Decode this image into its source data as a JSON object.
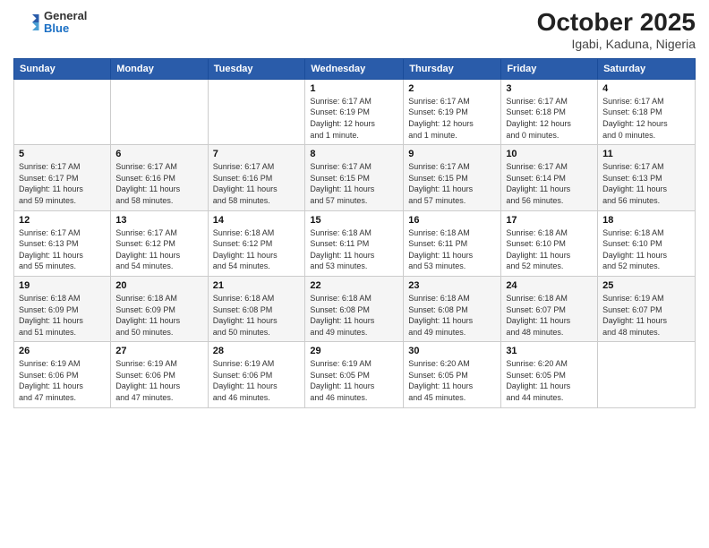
{
  "header": {
    "logo": {
      "general": "General",
      "blue": "Blue"
    },
    "title": "October 2025",
    "subtitle": "Igabi, Kaduna, Nigeria"
  },
  "calendar": {
    "days_of_week": [
      "Sunday",
      "Monday",
      "Tuesday",
      "Wednesday",
      "Thursday",
      "Friday",
      "Saturday"
    ],
    "weeks": [
      [
        {
          "day": "",
          "info": ""
        },
        {
          "day": "",
          "info": ""
        },
        {
          "day": "",
          "info": ""
        },
        {
          "day": "1",
          "info": "Sunrise: 6:17 AM\nSunset: 6:19 PM\nDaylight: 12 hours\nand 1 minute."
        },
        {
          "day": "2",
          "info": "Sunrise: 6:17 AM\nSunset: 6:19 PM\nDaylight: 12 hours\nand 1 minute."
        },
        {
          "day": "3",
          "info": "Sunrise: 6:17 AM\nSunset: 6:18 PM\nDaylight: 12 hours\nand 0 minutes."
        },
        {
          "day": "4",
          "info": "Sunrise: 6:17 AM\nSunset: 6:18 PM\nDaylight: 12 hours\nand 0 minutes."
        }
      ],
      [
        {
          "day": "5",
          "info": "Sunrise: 6:17 AM\nSunset: 6:17 PM\nDaylight: 11 hours\nand 59 minutes."
        },
        {
          "day": "6",
          "info": "Sunrise: 6:17 AM\nSunset: 6:16 PM\nDaylight: 11 hours\nand 58 minutes."
        },
        {
          "day": "7",
          "info": "Sunrise: 6:17 AM\nSunset: 6:16 PM\nDaylight: 11 hours\nand 58 minutes."
        },
        {
          "day": "8",
          "info": "Sunrise: 6:17 AM\nSunset: 6:15 PM\nDaylight: 11 hours\nand 57 minutes."
        },
        {
          "day": "9",
          "info": "Sunrise: 6:17 AM\nSunset: 6:15 PM\nDaylight: 11 hours\nand 57 minutes."
        },
        {
          "day": "10",
          "info": "Sunrise: 6:17 AM\nSunset: 6:14 PM\nDaylight: 11 hours\nand 56 minutes."
        },
        {
          "day": "11",
          "info": "Sunrise: 6:17 AM\nSunset: 6:13 PM\nDaylight: 11 hours\nand 56 minutes."
        }
      ],
      [
        {
          "day": "12",
          "info": "Sunrise: 6:17 AM\nSunset: 6:13 PM\nDaylight: 11 hours\nand 55 minutes."
        },
        {
          "day": "13",
          "info": "Sunrise: 6:17 AM\nSunset: 6:12 PM\nDaylight: 11 hours\nand 54 minutes."
        },
        {
          "day": "14",
          "info": "Sunrise: 6:18 AM\nSunset: 6:12 PM\nDaylight: 11 hours\nand 54 minutes."
        },
        {
          "day": "15",
          "info": "Sunrise: 6:18 AM\nSunset: 6:11 PM\nDaylight: 11 hours\nand 53 minutes."
        },
        {
          "day": "16",
          "info": "Sunrise: 6:18 AM\nSunset: 6:11 PM\nDaylight: 11 hours\nand 53 minutes."
        },
        {
          "day": "17",
          "info": "Sunrise: 6:18 AM\nSunset: 6:10 PM\nDaylight: 11 hours\nand 52 minutes."
        },
        {
          "day": "18",
          "info": "Sunrise: 6:18 AM\nSunset: 6:10 PM\nDaylight: 11 hours\nand 52 minutes."
        }
      ],
      [
        {
          "day": "19",
          "info": "Sunrise: 6:18 AM\nSunset: 6:09 PM\nDaylight: 11 hours\nand 51 minutes."
        },
        {
          "day": "20",
          "info": "Sunrise: 6:18 AM\nSunset: 6:09 PM\nDaylight: 11 hours\nand 50 minutes."
        },
        {
          "day": "21",
          "info": "Sunrise: 6:18 AM\nSunset: 6:08 PM\nDaylight: 11 hours\nand 50 minutes."
        },
        {
          "day": "22",
          "info": "Sunrise: 6:18 AM\nSunset: 6:08 PM\nDaylight: 11 hours\nand 49 minutes."
        },
        {
          "day": "23",
          "info": "Sunrise: 6:18 AM\nSunset: 6:08 PM\nDaylight: 11 hours\nand 49 minutes."
        },
        {
          "day": "24",
          "info": "Sunrise: 6:18 AM\nSunset: 6:07 PM\nDaylight: 11 hours\nand 48 minutes."
        },
        {
          "day": "25",
          "info": "Sunrise: 6:19 AM\nSunset: 6:07 PM\nDaylight: 11 hours\nand 48 minutes."
        }
      ],
      [
        {
          "day": "26",
          "info": "Sunrise: 6:19 AM\nSunset: 6:06 PM\nDaylight: 11 hours\nand 47 minutes."
        },
        {
          "day": "27",
          "info": "Sunrise: 6:19 AM\nSunset: 6:06 PM\nDaylight: 11 hours\nand 47 minutes."
        },
        {
          "day": "28",
          "info": "Sunrise: 6:19 AM\nSunset: 6:06 PM\nDaylight: 11 hours\nand 46 minutes."
        },
        {
          "day": "29",
          "info": "Sunrise: 6:19 AM\nSunset: 6:05 PM\nDaylight: 11 hours\nand 46 minutes."
        },
        {
          "day": "30",
          "info": "Sunrise: 6:20 AM\nSunset: 6:05 PM\nDaylight: 11 hours\nand 45 minutes."
        },
        {
          "day": "31",
          "info": "Sunrise: 6:20 AM\nSunset: 6:05 PM\nDaylight: 11 hours\nand 44 minutes."
        },
        {
          "day": "",
          "info": ""
        }
      ]
    ]
  }
}
